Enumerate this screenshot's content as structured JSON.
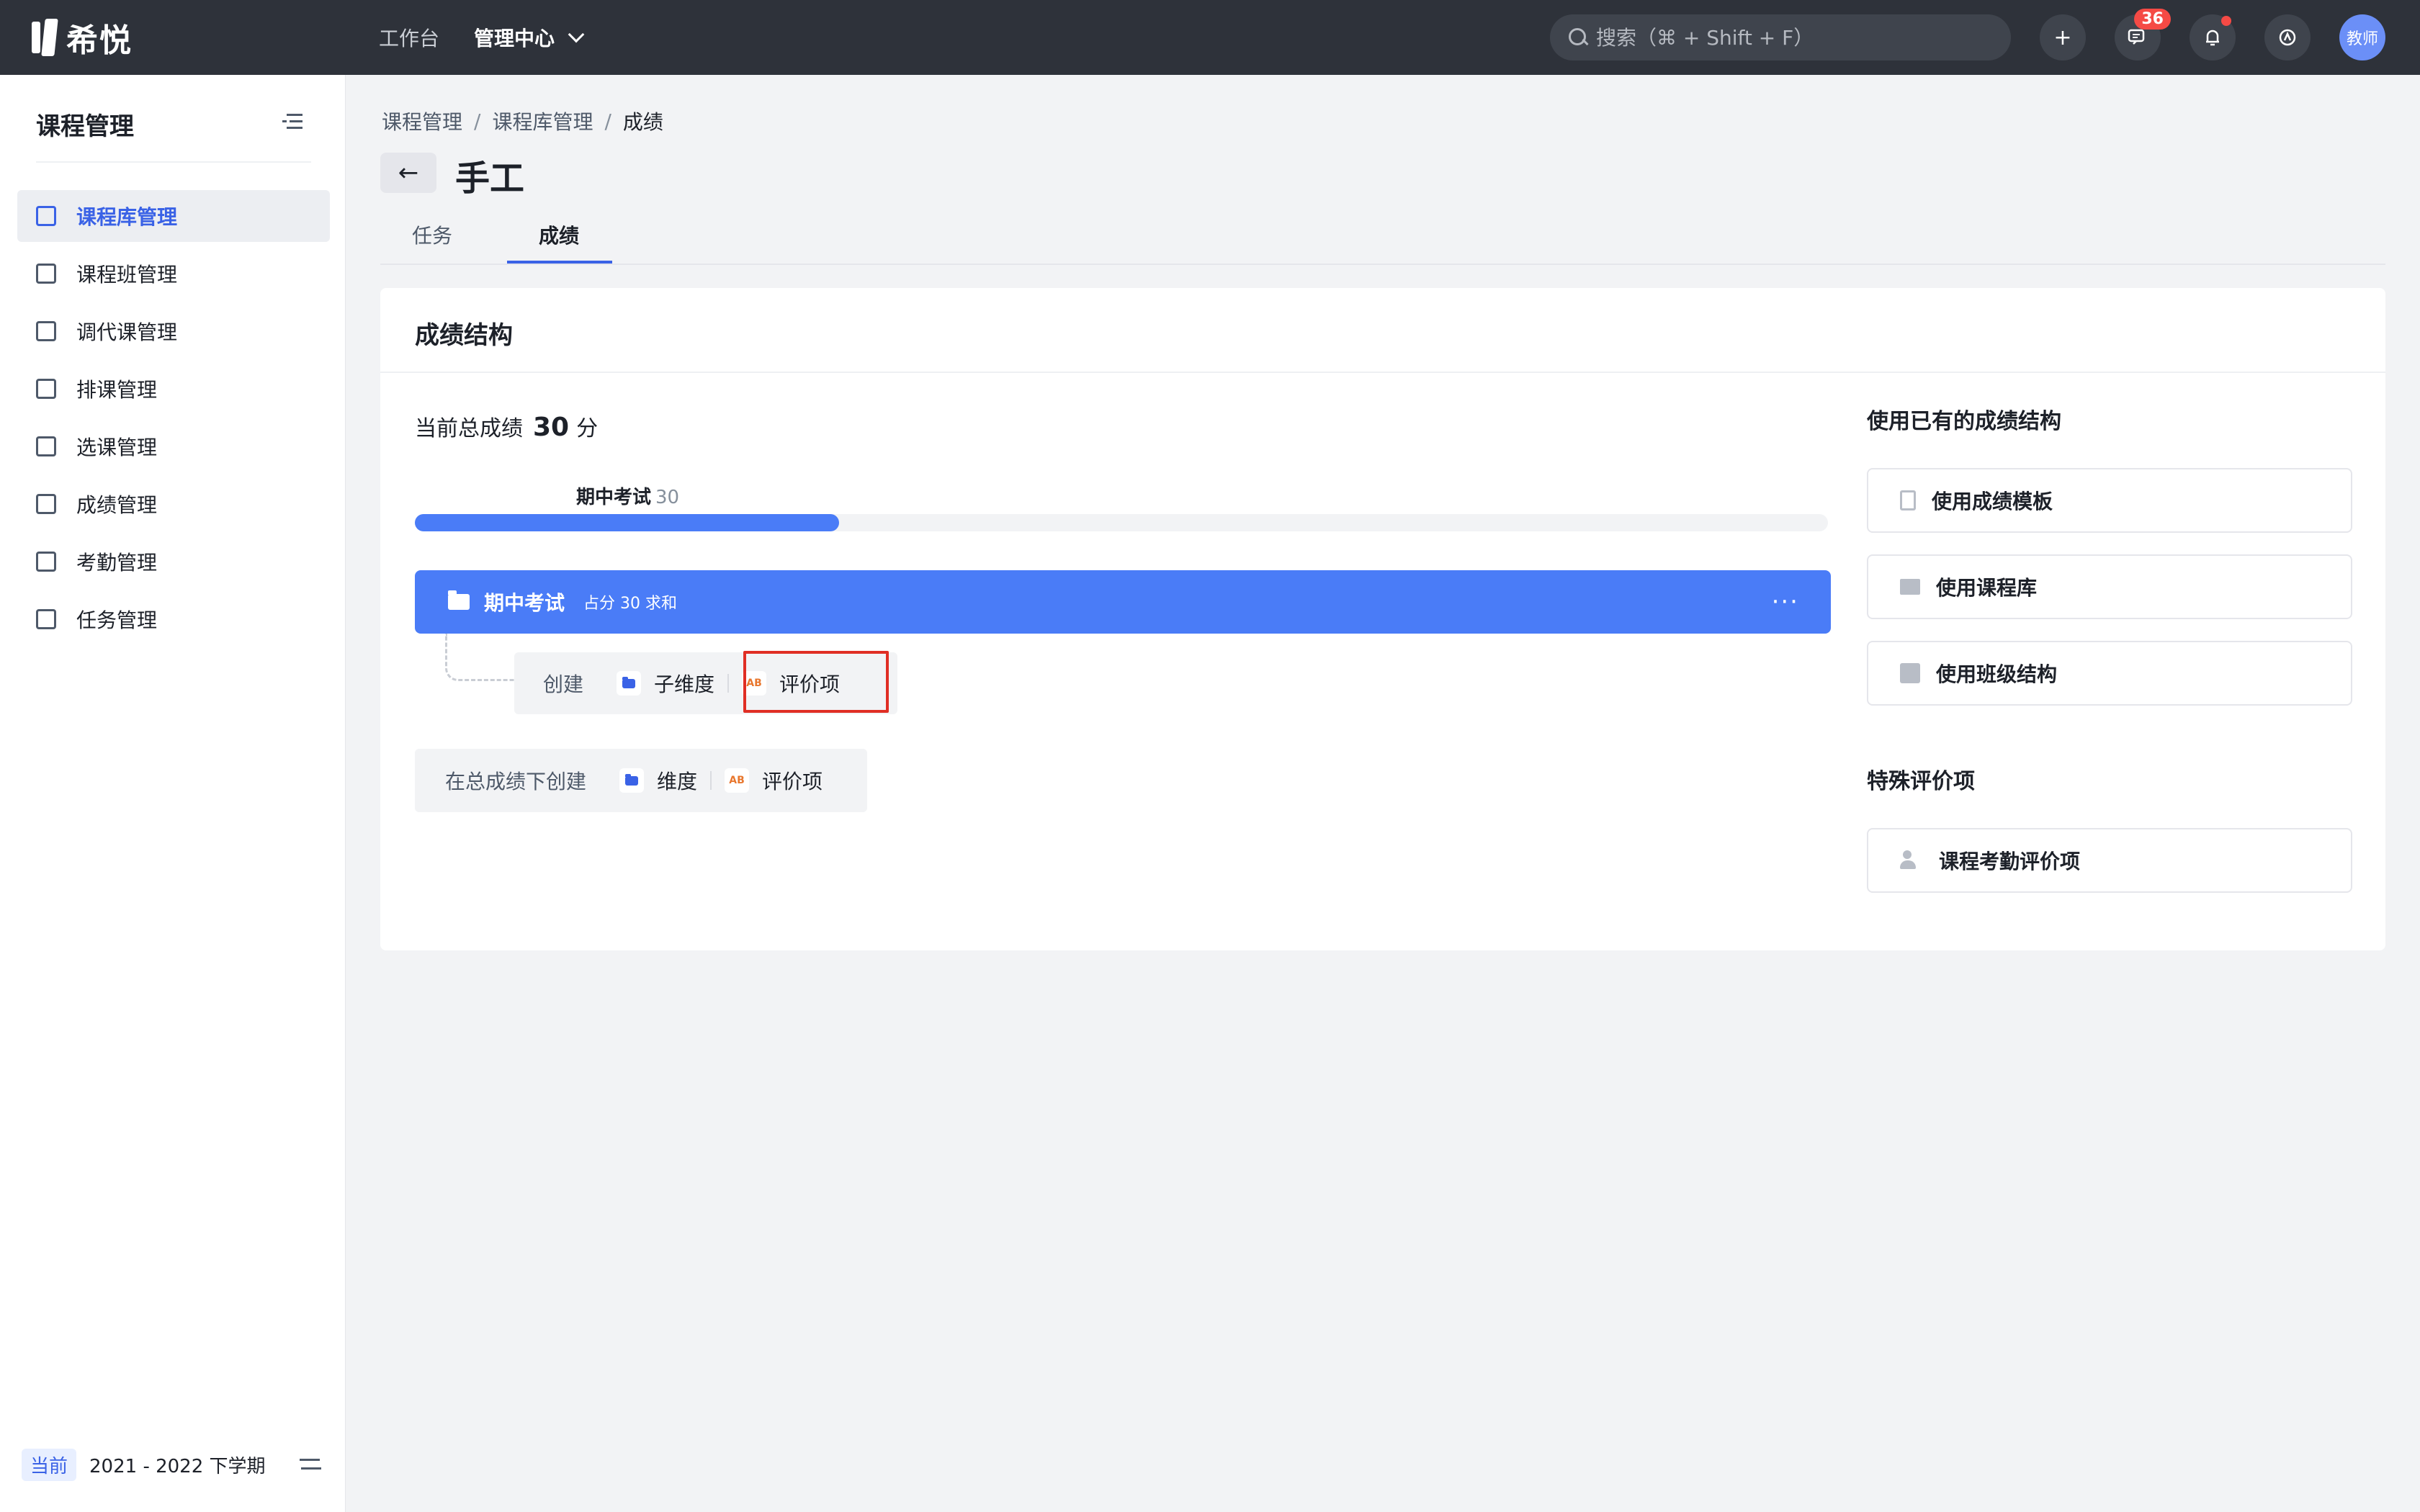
{
  "app": {
    "name": "希悦"
  },
  "topnav": {
    "items": [
      "工作台",
      "管理中心"
    ]
  },
  "search": {
    "placeholder": "搜索（⌘ + Shift + F）"
  },
  "top_icons": {
    "add": "+",
    "messages_badge": "36",
    "avatar": "教师"
  },
  "sidebar": {
    "title": "课程管理",
    "items": [
      {
        "label": "课程库管理",
        "icon": "stack-icon",
        "active": true
      },
      {
        "label": "课程班管理",
        "icon": "class-icon"
      },
      {
        "label": "调代课管理",
        "icon": "swap-class-icon"
      },
      {
        "label": "排课管理",
        "icon": "schedule-icon"
      },
      {
        "label": "选课管理",
        "icon": "checklist-icon"
      },
      {
        "label": "成绩管理",
        "icon": "grade-icon"
      },
      {
        "label": "考勤管理",
        "icon": "calendar-icon"
      },
      {
        "label": "任务管理",
        "icon": "task-list-icon"
      }
    ],
    "footer": {
      "tag": "当前",
      "term": "2021 - 2022 下学期"
    }
  },
  "breadcrumb": [
    "课程管理",
    "课程库管理",
    "成绩"
  ],
  "page": {
    "title": "手工"
  },
  "tabs": [
    {
      "label": "任务"
    },
    {
      "label": "成绩",
      "active": true
    }
  ],
  "card": {
    "title": "成绩结构",
    "total_prefix": "当前总成绩",
    "total_value": "30",
    "total_unit": "分",
    "progress": {
      "label": "期中考试",
      "value": "30",
      "fraction": 0.3
    },
    "dimension": {
      "name": "期中考试",
      "desc": "占分 30 求和",
      "more": "···"
    },
    "child_create": {
      "label": "创建",
      "sub_dimension": "子维度",
      "eval_item": "评价项"
    },
    "root_create": {
      "label": "在总成绩下创建",
      "dimension": "维度",
      "eval_item": "评价项"
    }
  },
  "right": {
    "existing_title": "使用已有的成绩结构",
    "buttons": [
      "使用成绩模板",
      "使用课程库",
      "使用班级结构"
    ],
    "special_title": "特殊评价项",
    "special_buttons": [
      "课程考勤评价项"
    ]
  },
  "colors": {
    "accent": "#4a7cf7",
    "link": "#3a62e6",
    "topbar": "#2e323a",
    "highlight": "#e02e24"
  }
}
